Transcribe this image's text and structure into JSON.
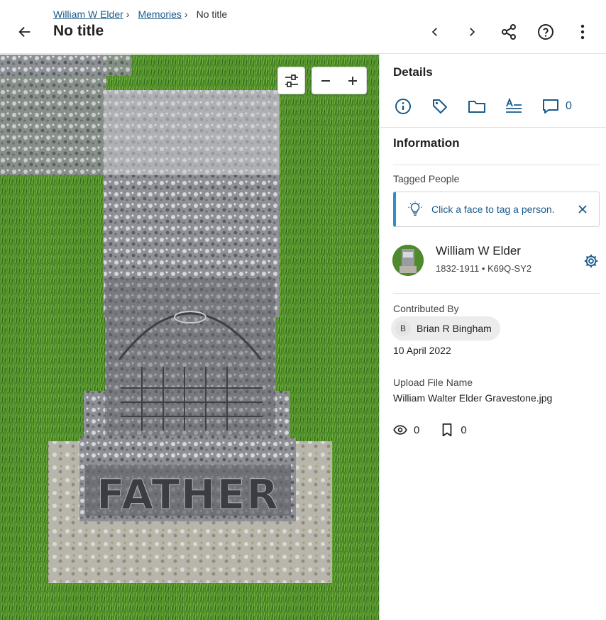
{
  "breadcrumb": {
    "items": [
      "William W Elder",
      "Memories"
    ],
    "current": "No title",
    "separator": "›"
  },
  "header": {
    "title": "No title",
    "icons": [
      "back-arrow-icon",
      "chevron-left-icon",
      "chevron-right-icon",
      "share-icon",
      "help-icon",
      "more-vertical-icon"
    ]
  },
  "viewer": {
    "image_subject": "gravestone-photo",
    "engraving": "FATHER",
    "tools": [
      "adjust-sliders-icon",
      "zoom-out-icon",
      "zoom-in-icon"
    ]
  },
  "panel": {
    "title": "Details",
    "tabs": [
      "info-icon",
      "tag-icon",
      "folder-icon",
      "text-icon",
      "comment-icon"
    ],
    "comment_count": "0",
    "section_title": "Information",
    "tagged_people_label": "Tagged People",
    "tip_text": "Click a face to tag a person.",
    "person": {
      "name": "William W Elder",
      "meta": "1832-1911 • K69Q-SY2"
    },
    "contributed_by_label": "Contributed By",
    "contributor_initial": "B",
    "contributor_name": "Brian R Bingham",
    "contributed_date": "10 April 2022",
    "upload_file_label": "Upload File Name",
    "upload_file_name": "William Walter Elder Gravestone.jpg",
    "views": "0",
    "bookmarks": "0"
  },
  "colors": {
    "link": "#1a5a8a",
    "icon_blue": "#1a5a8a",
    "tip_border": "#2f8fc9",
    "grass": "#4f8a2c"
  }
}
